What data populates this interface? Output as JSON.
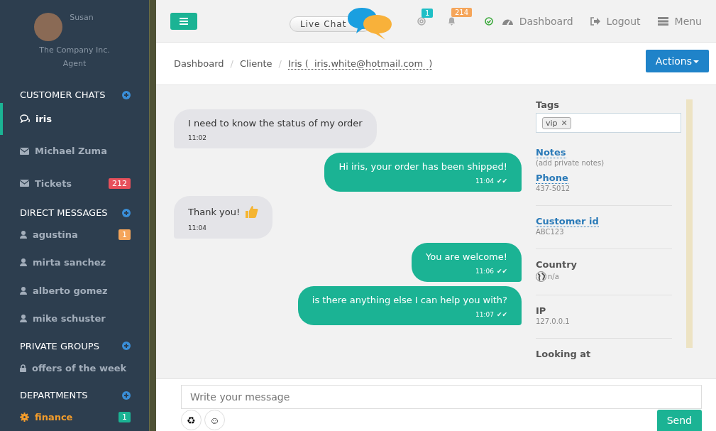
{
  "user": {
    "name": "Susan",
    "company": "The Company Inc.",
    "role": "Agent"
  },
  "sidebar": {
    "sections": [
      {
        "title": "CUSTOMER CHATS",
        "items": [
          {
            "kind": "chat",
            "label": "iris",
            "selected": true,
            "highlighted": false
          },
          {
            "kind": "mail",
            "label": "Michael Zuma",
            "selected": false,
            "highlighted": false
          },
          {
            "kind": "mail",
            "label": "Tickets",
            "selected": false,
            "highlighted": false,
            "badge": "212",
            "color": "#e8505b"
          }
        ]
      },
      {
        "title": "DIRECT MESSAGES",
        "items": [
          {
            "kind": "user",
            "label": "agustina",
            "selected": false,
            "highlighted": false,
            "badge": "1",
            "color": "#f5a55a"
          },
          {
            "kind": "user",
            "label": "mirta sanchez",
            "selected": false,
            "highlighted": false
          },
          {
            "kind": "user",
            "label": "alberto gomez",
            "selected": false,
            "highlighted": false
          },
          {
            "kind": "user",
            "label": "mike schuster",
            "selected": false,
            "highlighted": false
          }
        ]
      },
      {
        "title": "PRIVATE GROUPS",
        "items": [
          {
            "kind": "lock",
            "label": "offers of the week",
            "selected": false,
            "highlighted": false
          }
        ]
      },
      {
        "title": "DEPARTMENTS",
        "items": [
          {
            "kind": "gear",
            "label": "finance",
            "selected": false,
            "highlighted": true,
            "badge": "1",
            "color": "#1bb394"
          }
        ]
      }
    ]
  },
  "topbar": {
    "logo": "Live Chat",
    "mentions_badge": "1",
    "alerts_badge": "214",
    "links": [
      {
        "kind": "dashboard",
        "label": "Dashboard"
      },
      {
        "kind": "logout",
        "label": "Logout"
      },
      {
        "kind": "menu",
        "label": "Menu"
      }
    ]
  },
  "breadcrumb": [
    "Dashboard",
    "Cliente",
    "Iris (  iris.white@hotmail.com  )"
  ],
  "breadcrumb_separator": "/",
  "actions_button": "Actions",
  "messages": [
    {
      "kind": "incoming",
      "text": "I need to know the status of my order",
      "time": "11:02",
      "thumbs_up": false
    },
    {
      "kind": "outgoing",
      "text": "Hi iris, your order has been shipped!",
      "time": "11:04",
      "read_mark": "✔✔",
      "thumbs_up": false
    },
    {
      "kind": "incoming",
      "text": "Thank you!",
      "time": "11:04",
      "thumbs_up": true
    },
    {
      "kind": "outgoing",
      "text": "You are welcome!",
      "time": "11:06",
      "read_mark": "✔✔",
      "thumbs_up": false
    },
    {
      "kind": "outgoing",
      "text": "is there anything else I can help you with?",
      "time": "11:07",
      "read_mark": "✔✔",
      "thumbs_up": false
    }
  ],
  "details": [
    {
      "kind": "tags",
      "label": "Tags",
      "tags": [
        "vip"
      ],
      "remove_mark": "✕"
    },
    {
      "kind": "editable",
      "label": "Notes",
      "value": "(add private notes)",
      "divider": false
    },
    {
      "kind": "editable",
      "label": "Phone",
      "value": "437-5012",
      "divider": true
    },
    {
      "kind": "editable",
      "label": "Customer id",
      "value": "ABC123",
      "divider": true
    },
    {
      "kind": "country",
      "label": "Country",
      "value": "n/a",
      "divider": true
    },
    {
      "kind": "plain",
      "label": "IP",
      "value": "127.0.0.1",
      "divider": true
    },
    {
      "kind": "plain",
      "label": "Looking at",
      "divider": false
    }
  ],
  "composer": {
    "placeholder": "Write your message",
    "buttons": [
      "♻",
      "☺"
    ],
    "send": "Send"
  }
}
